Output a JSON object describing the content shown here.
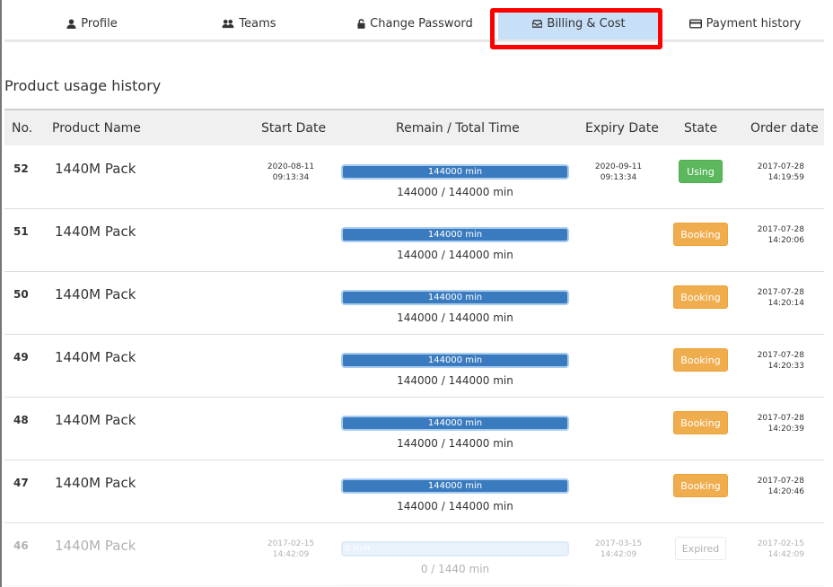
{
  "tabs": [
    {
      "label": "Profile",
      "icon": "user-icon"
    },
    {
      "label": "Teams",
      "icon": "users-icon"
    },
    {
      "label": "Change Password",
      "icon": "lock-icon"
    },
    {
      "label": "Billing & Cost",
      "icon": "inbox-icon",
      "active": true
    },
    {
      "label": "Payment history",
      "icon": "credit-card-icon"
    }
  ],
  "section_title": "Product usage history",
  "columns": [
    "No.",
    "Product Name",
    "Start Date",
    "Remain / Total Time",
    "Expiry Date",
    "State",
    "Order date"
  ],
  "rows": [
    {
      "no": "52",
      "name": "1440M Pack",
      "start_date": "2020-08-11",
      "start_time": "09:13:34",
      "bar_label": "144000 min",
      "remain_text": "144000 / 144000 min",
      "expiry_date": "2020-09-11",
      "expiry_time": "09:13:34",
      "state": "Using",
      "order_date": "2017-07-28",
      "order_time": "14:19:59"
    },
    {
      "no": "51",
      "name": "1440M Pack",
      "start_date": "",
      "start_time": "",
      "bar_label": "144000 min",
      "remain_text": "144000 / 144000 min",
      "expiry_date": "",
      "expiry_time": "",
      "state": "Booking",
      "order_date": "2017-07-28",
      "order_time": "14:20:06"
    },
    {
      "no": "50",
      "name": "1440M Pack",
      "start_date": "",
      "start_time": "",
      "bar_label": "144000 min",
      "remain_text": "144000 / 144000 min",
      "expiry_date": "",
      "expiry_time": "",
      "state": "Booking",
      "order_date": "2017-07-28",
      "order_time": "14:20:14"
    },
    {
      "no": "49",
      "name": "1440M Pack",
      "start_date": "",
      "start_time": "",
      "bar_label": "144000 min",
      "remain_text": "144000 / 144000 min",
      "expiry_date": "",
      "expiry_time": "",
      "state": "Booking",
      "order_date": "2017-07-28",
      "order_time": "14:20:33"
    },
    {
      "no": "48",
      "name": "1440M Pack",
      "start_date": "",
      "start_time": "",
      "bar_label": "144000 min",
      "remain_text": "144000 / 144000 min",
      "expiry_date": "",
      "expiry_time": "",
      "state": "Booking",
      "order_date": "2017-07-28",
      "order_time": "14:20:39"
    },
    {
      "no": "47",
      "name": "1440M Pack",
      "start_date": "",
      "start_time": "",
      "bar_label": "144000 min",
      "remain_text": "144000 / 144000 min",
      "expiry_date": "",
      "expiry_time": "",
      "state": "Booking",
      "order_date": "2017-07-28",
      "order_time": "14:20:46"
    },
    {
      "no": "46",
      "name": "1440M Pack",
      "start_date": "2017-02-15",
      "start_time": "14:42:09",
      "bar_label": "0 min",
      "remain_text": "0 / 1440 min",
      "expiry_date": "2017-03-15",
      "expiry_time": "14:42:09",
      "state": "Expired",
      "order_date": "2017-02-15",
      "order_time": "14:42:09"
    }
  ],
  "colors": {
    "using": "#5cb85c",
    "booking": "#f0ad4e",
    "bar": "#3a7bbf",
    "active_tab": "#c7dff7",
    "highlight": "#ff0000"
  }
}
